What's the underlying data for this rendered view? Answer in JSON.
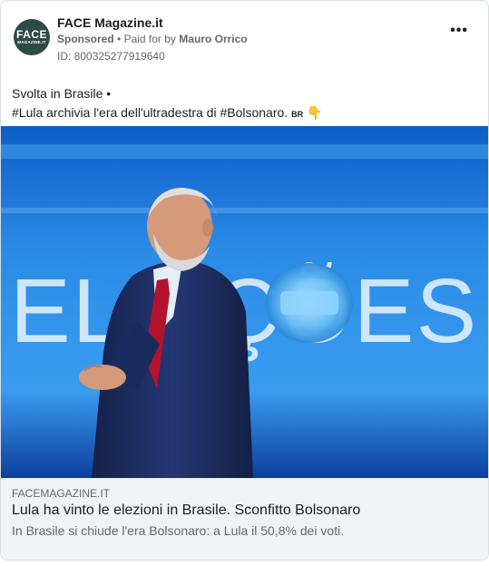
{
  "advertiser": {
    "avatar_text_big": "FACE",
    "avatar_text_small": "MAGAZINE.IT",
    "name": "FACE Magazine.it",
    "sponsored_label": "Sponsored",
    "separator": "•",
    "paid_for_prefix": "Paid for by",
    "payer": "Mauro Orrico",
    "ad_id": "ID: 800325277919640",
    "more_label": "•••"
  },
  "post": {
    "line1": "Svolta in Brasile •",
    "line2": "#Lula archivia l'era dell'ultradestra di #Bolsonaro.",
    "flag_code": "BR",
    "emoji": "👇"
  },
  "media": {
    "backdrop_text": "ELEIÇÕES"
  },
  "link": {
    "domain": "FACEMAGAZINE.IT",
    "title": "Lula ha vinto le elezioni in Brasile. Sconfitto Bolsonaro",
    "description": "In Brasile si chiude l'era Bolsonaro: a Lula il 50,8% dei voti."
  },
  "colors": {
    "avatar_bg": "#2e4a47",
    "backdrop_blue": "#1f7fd9",
    "suit": "#1d2b5a"
  }
}
